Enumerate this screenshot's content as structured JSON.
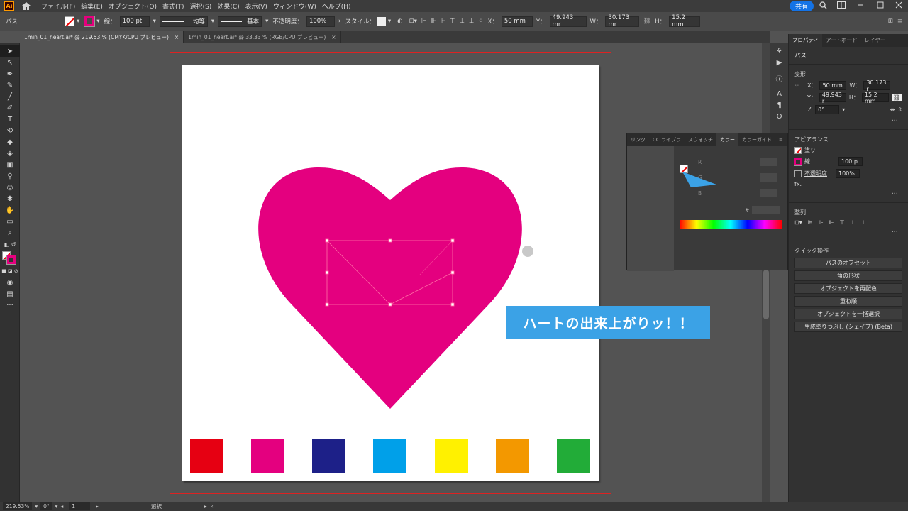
{
  "menubar": {
    "logo": "Ai",
    "items": [
      "ファイル(F)",
      "編集(E)",
      "オブジェクト(O)",
      "書式(T)",
      "選択(S)",
      "効果(C)",
      "表示(V)",
      "ウィンドウ(W)",
      "ヘルプ(H)"
    ],
    "share": "共有"
  },
  "controlbar": {
    "object_type": "パス",
    "stroke_label": "線：",
    "stroke_weight": "100 pt",
    "stroke_profile": "均等",
    "brush": "基本",
    "opacity_label": "不透明度：",
    "opacity": "100%",
    "style_label": "スタイル：",
    "x_label": "X：",
    "x": "50 mm",
    "y_label": "Y：",
    "y": "49.943 mr",
    "w_label": "W：",
    "w": "30.173 mr",
    "h_label": "H：",
    "h": "15.2 mm"
  },
  "tabs": [
    {
      "label": "1min_01_heart.ai* @ 219.53 % (CMYK/CPU プレビュー)",
      "close": "×"
    },
    {
      "label": "1min_01_heart.ai* @ 33.33 % (RGB/CPU プレビュー)",
      "close": "×"
    }
  ],
  "properties": {
    "tabs": [
      "プロパティ",
      "アートボード",
      "レイヤー"
    ],
    "title": "パス",
    "transform_label": "変形",
    "x_label": "X：",
    "x": "50 mm",
    "y_label": "Y：",
    "y": "49.943 r",
    "w_label": "W：",
    "w": "30.173 r",
    "h_label": "H：",
    "h": "15.2 mm",
    "angle": "0°",
    "appearance_label": "アピアランス",
    "fill_label": "塗り",
    "stroke_label": "線",
    "stroke_value": "100 p",
    "opacity_label": "不透明度",
    "opacity": "100%",
    "fx": "fx.",
    "align_label": "整列",
    "quick_label": "クイック操作",
    "buttons": [
      "パスのオフセット",
      "角の形状",
      "オブジェクトを再配色",
      "重ね順",
      "オブジェクトを一括選択",
      "生成塗りつぶし (シェイプ) (Beta)"
    ]
  },
  "colorpanel": {
    "tabs_left": [
      "リンク",
      "CC ライブラ"
    ],
    "tabs_right": [
      "スウォッチ",
      "カラー",
      "カラーガイド"
    ],
    "r": "R",
    "g": "G",
    "b": "B",
    "hash": "#"
  },
  "callout": "ハートの出来上がりッ！！",
  "statusbar": {
    "zoom": "219.53%",
    "rotate": "0°",
    "artboard": "1",
    "tool": "選択"
  },
  "colors": {
    "heart": "#e4007f",
    "swatches": [
      "#e60012",
      "#e4007f",
      "#1d2088",
      "#00a0e9",
      "#fff100",
      "#f39800",
      "#22ac38"
    ],
    "accent": "#1473e6",
    "callout_bg": "#3ba2e6"
  }
}
